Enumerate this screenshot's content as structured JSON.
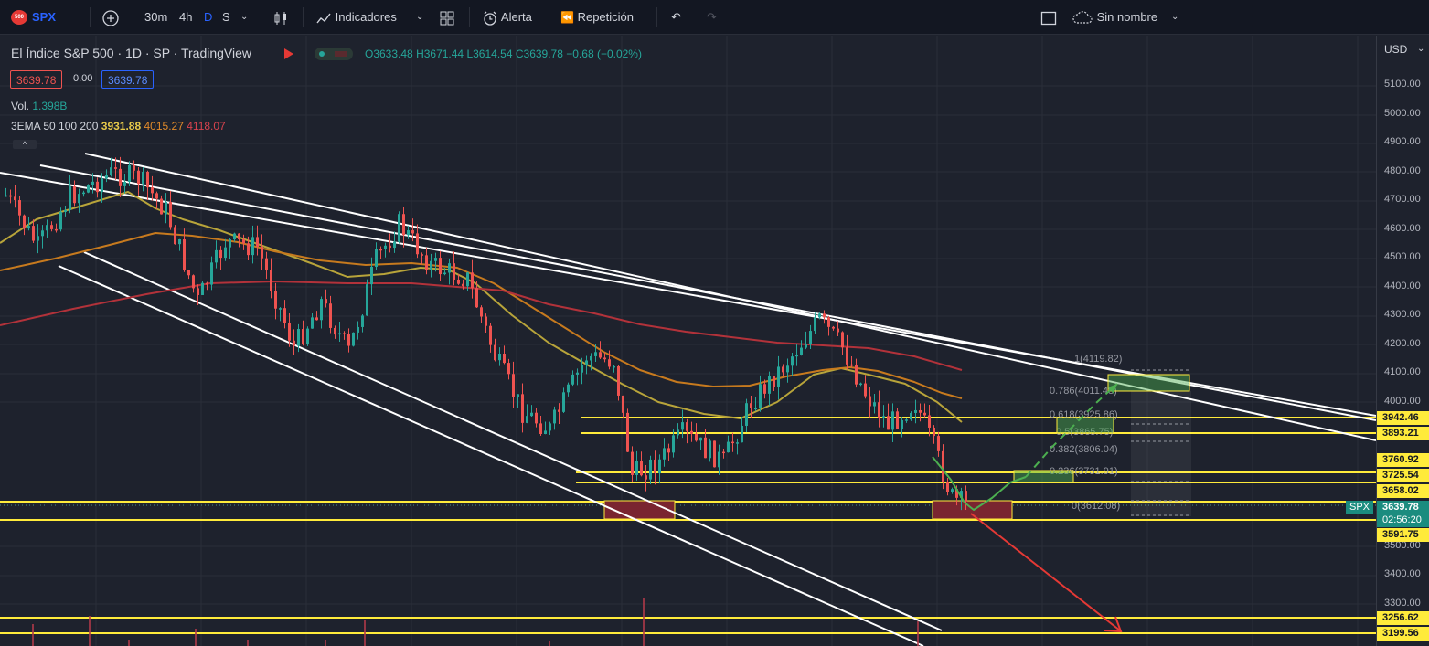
{
  "toolbar": {
    "symbol": "SPX",
    "logo_text": "500",
    "intervals": [
      "30m",
      "4h",
      "D",
      "S"
    ],
    "active_interval": "D",
    "indicators_label": "Indicadores",
    "alert_label": "Alerta",
    "replay_label": "Repetición",
    "layout_name": "Sin nombre"
  },
  "legend": {
    "title": "El Índice S&P 500 · 1D · SP · TradingView",
    "open": "O3633.48",
    "high": "H3671.44",
    "low": "L3614.54",
    "close": "C3639.78",
    "change": "−0.68 (−0.02%)",
    "bid": "3639.78",
    "spread": "0.00",
    "ask": "3639.78",
    "volume_label": "Vol.",
    "volume_value": "1.398B",
    "ema_label": "3EMA 50 100 200",
    "ema50": "3931.88",
    "ema100": "4015.27",
    "ema200": "4118.07"
  },
  "axis": {
    "currency": "USD",
    "ticks": [
      "5100.00",
      "5000.00",
      "4900.00",
      "4800.00",
      "4700.00",
      "4600.00",
      "4500.00",
      "4400.00",
      "4300.00",
      "4200.00",
      "4100.00",
      "4000.00",
      "3500.00",
      "3400.00",
      "3300.00"
    ],
    "price_labels": [
      {
        "text": "3942.46",
        "type": "level"
      },
      {
        "text": "3893.21",
        "type": "level"
      },
      {
        "text": "3760.92",
        "type": "level"
      },
      {
        "text": "3725.54",
        "type": "level"
      },
      {
        "text": "3658.02",
        "type": "level"
      },
      {
        "text": "3591.75",
        "type": "level"
      },
      {
        "text": "3256.62",
        "type": "level"
      },
      {
        "text": "3199.56",
        "type": "level"
      }
    ],
    "last_price": "3639.78",
    "countdown": "02:56:20",
    "symbol_tag": "SPX"
  },
  "fib_labels": [
    "1(4119.82)",
    "0.786(4011.48)",
    "0.618(3925.86)",
    "0.5(3865.75)",
    "0.382(3806.04)",
    "0.236(3731.91)",
    "0(3612.08)"
  ],
  "colors": {
    "up": "#26a69a",
    "down": "#ef5350",
    "level": "#ffeb3b",
    "ema50": "#b8a43a",
    "ema100": "#c77a1e",
    "ema200": "#b2323a",
    "trend": "#ffffff",
    "projection": "#4caf50",
    "bear_arrow": "#e53935"
  }
}
